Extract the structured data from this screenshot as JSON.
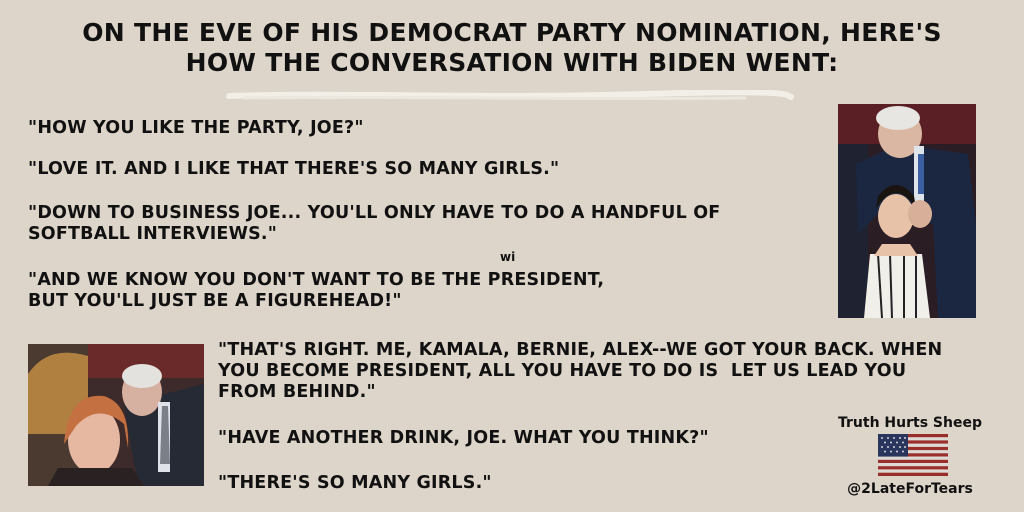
{
  "title": {
    "line1": "ON THE EVE OF HIS DEMOCRAT PARTY NOMINATION, HERE'S",
    "line2": "HOW THE CONVERSATION WITH BIDEN WENT:"
  },
  "dialogue": {
    "l1": "\"HOW YOU LIKE THE PARTY, JOE?\"",
    "l2": "\"LOVE IT. AND I LIKE THAT THERE'S SO MANY GIRLS.\"",
    "l3a": "\"DOWN TO BUSINESS JOE... YOU'LL ONLY HAVE TO DO A HANDFUL OF",
    "l3b": "SOFTBALL INTERVIEWS.\"",
    "stray": "wi",
    "l4a": "\"AND WE KNOW YOU DON'T WANT TO BE THE PRESIDENT,",
    "l4b": "BUT YOU'LL JUST BE A FIGUREHEAD!\"",
    "l5a": "\"THAT'S RIGHT. ME, KAMALA, BERNIE, ALEX--WE GOT YOUR BACK. WHEN",
    "l5b": "YOU BECOME PRESIDENT, ALL YOU HAVE TO DO IS  LET US LEAD YOU",
    "l5c": "FROM BEHIND.\"",
    "l6": "\"HAVE ANOTHER DRINK, JOE. WHAT YOU THINK?\"",
    "l7": "\"THERE'S SO MANY GIRLS.\""
  },
  "brand": {
    "name": "Truth Hurts Sheep",
    "handle": "@2LateForTears",
    "flag_icon": "us-flag-icon"
  },
  "colors": {
    "background": "#ddd5c9",
    "text": "#111111"
  }
}
